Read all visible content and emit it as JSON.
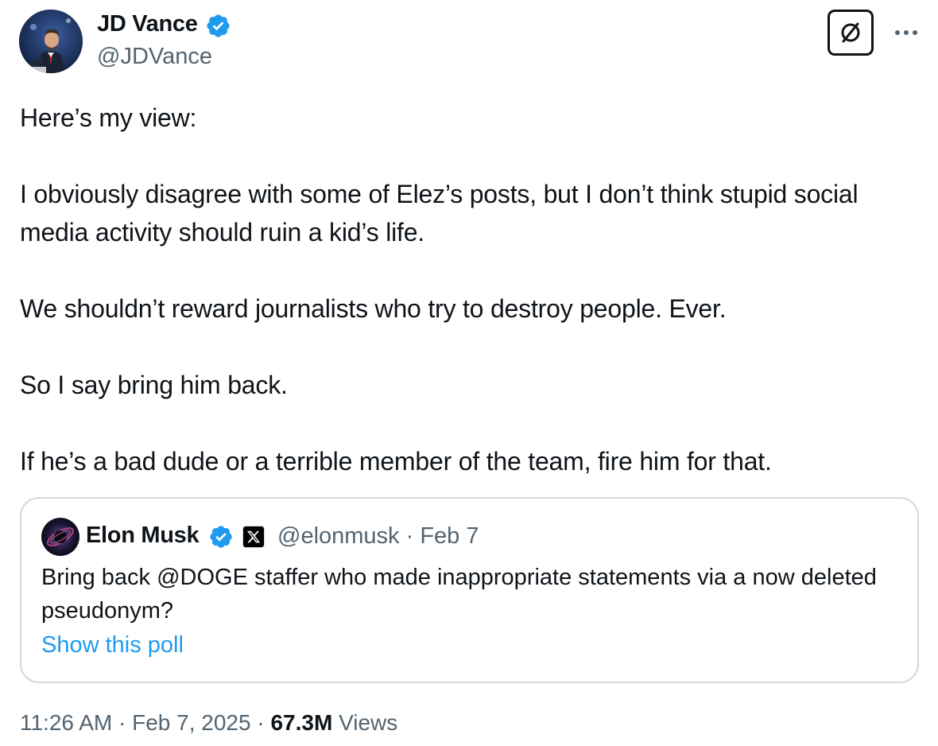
{
  "author": {
    "name": "JD Vance",
    "handle": "@JDVance",
    "verified": true,
    "verified_color": "#1d9bf0"
  },
  "actions": {
    "grok_icon": "slashed-circle-icon",
    "more_icon": "more-dots-icon"
  },
  "tweet": {
    "paragraphs": [
      "Here’s my view:",
      "I obviously disagree with some of Elez’s posts, but I don’t think stupid social media activity should ruin a kid’s life.",
      "We shouldn’t reward journalists who try to destroy people. Ever.",
      "So I say bring him back.",
      "If he’s a bad dude or a terrible member of the team, fire him for that."
    ]
  },
  "quote": {
    "author_name": "Elon Musk",
    "verified": true,
    "affiliate_badge": "x-logo-icon",
    "handle": "@elonmusk",
    "separator": " · ",
    "date": "Feb 7",
    "text": "Bring back @DOGE staffer who made inappropriate statements via a now deleted pseudonym?",
    "show_poll_label": "Show this poll",
    "link_color": "#1d9bf0"
  },
  "footer": {
    "time": "11:26 AM",
    "separator": " · ",
    "date": "Feb 7, 2025",
    "views_count": "67.3M",
    "views_label": " Views"
  },
  "colors": {
    "text_primary": "#0f1419",
    "text_secondary": "#536471",
    "border": "#cfd9de"
  }
}
